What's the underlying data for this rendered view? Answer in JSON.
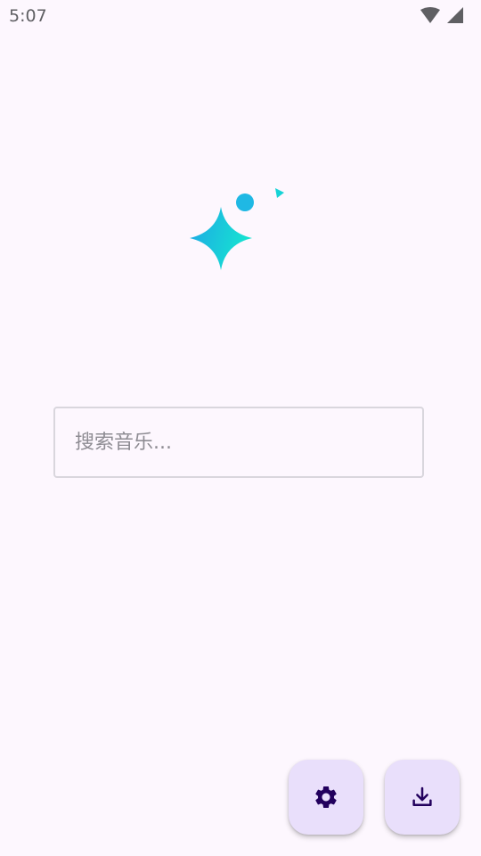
{
  "status_bar": {
    "time": "5:07",
    "icons": [
      "wifi-icon",
      "cellular-signal-icon"
    ]
  },
  "app": {
    "logo_icon": "sparkle-logo-icon",
    "gradient_colors": [
      "#1ea6e6",
      "#16e3d1"
    ]
  },
  "search": {
    "placeholder": "搜索音乐...",
    "value": ""
  },
  "fabs": [
    {
      "icon": "gear-icon",
      "action": "settings"
    },
    {
      "icon": "download-icon",
      "action": "downloads"
    }
  ],
  "colors": {
    "background": "#fdf7fe",
    "fab_background": "#e9dffb",
    "fab_icon": "#22005d",
    "field_border": "#d9d6dd"
  }
}
